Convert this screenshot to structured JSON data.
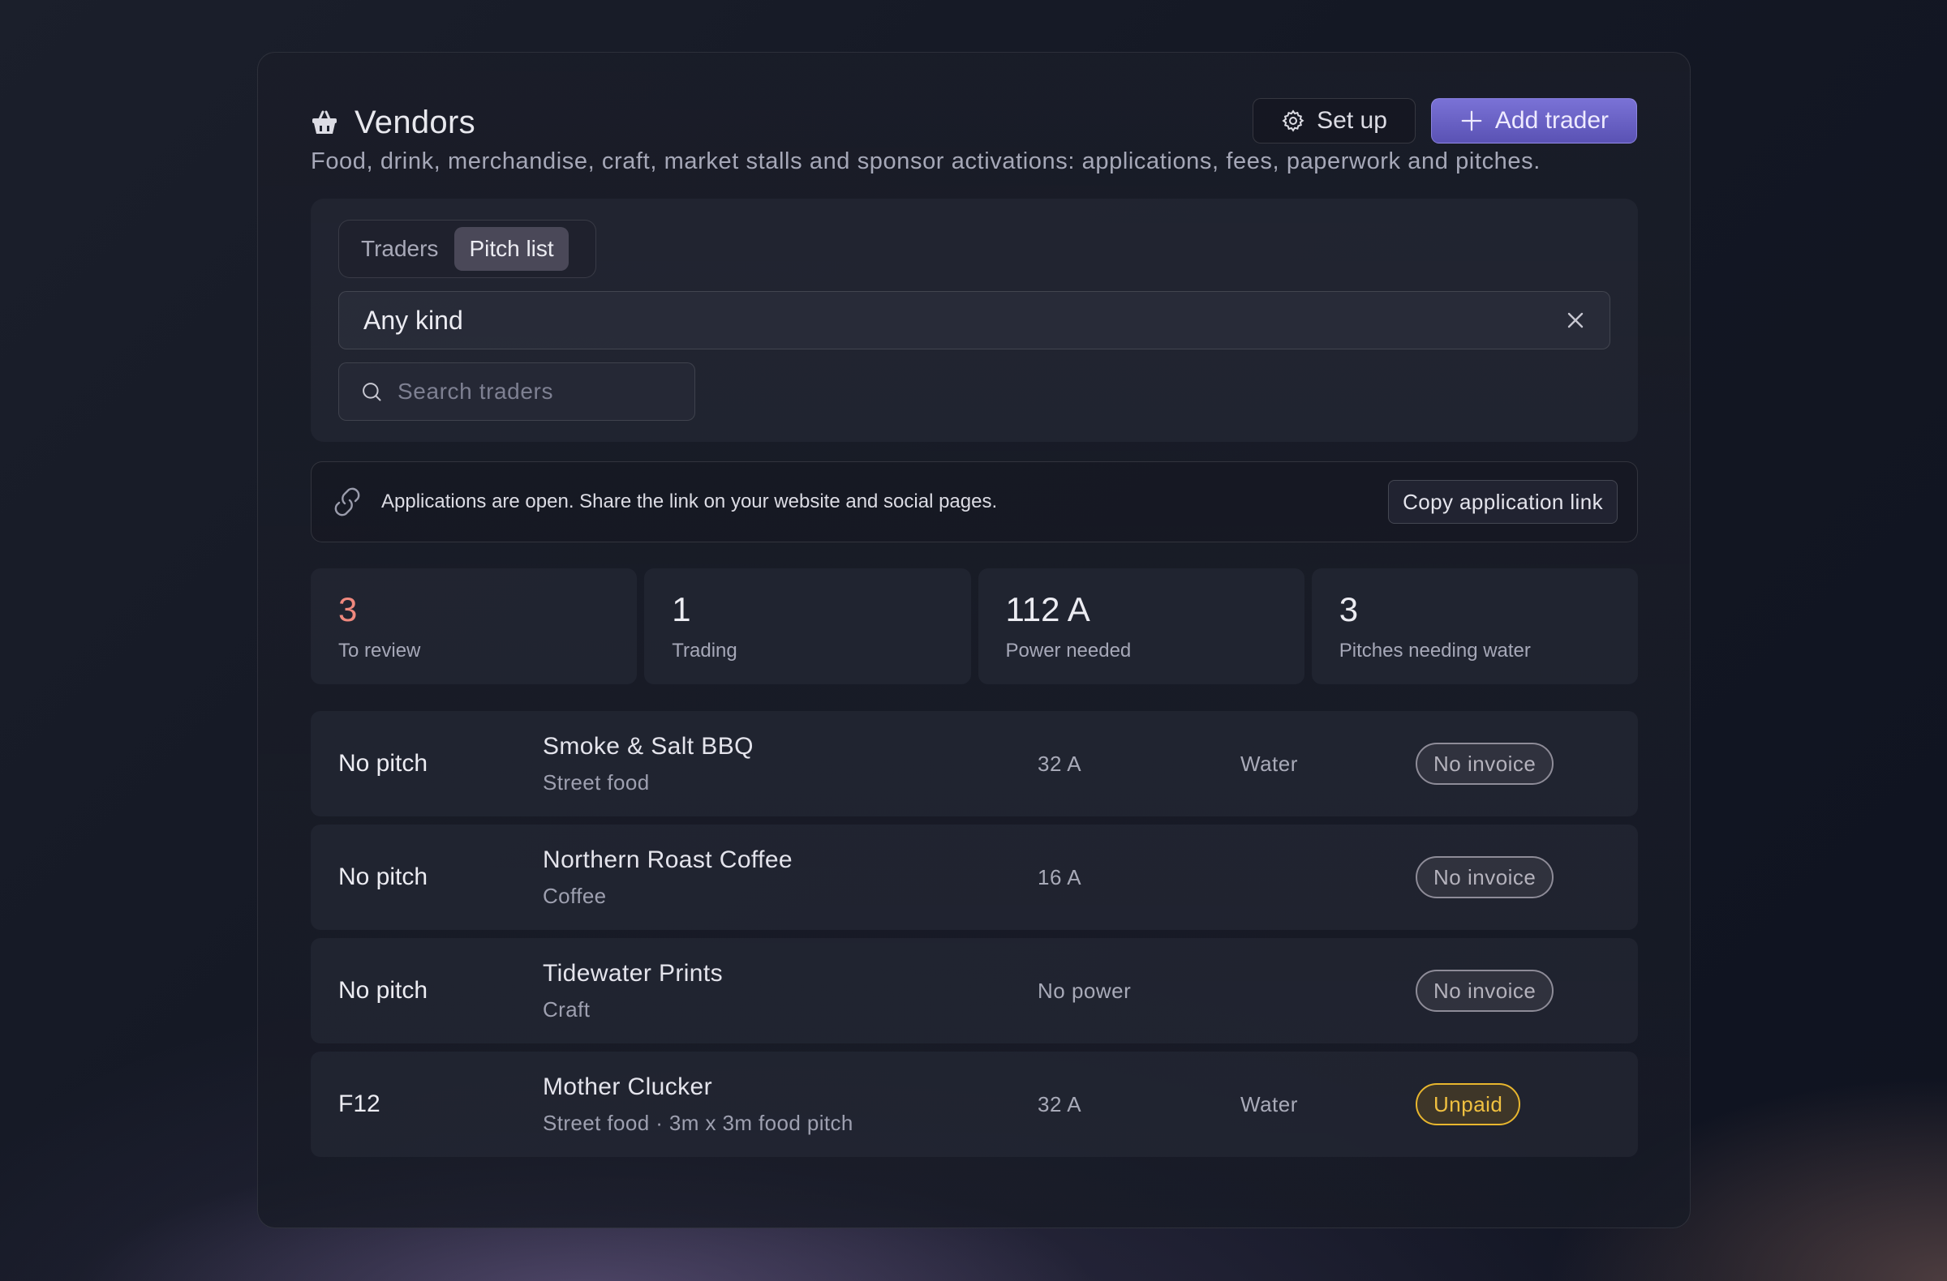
{
  "header": {
    "title": "Vendors",
    "subtitle": "Food, drink, merchandise, craft, market stalls and sponsor activations: applications, fees, paperwork and pitches.",
    "setup_label": "Set up",
    "add_label": "Add trader"
  },
  "filters": {
    "tabs": [
      {
        "label": "Traders",
        "active": false
      },
      {
        "label": "Pitch list",
        "active": true
      }
    ],
    "kind_value": "Any kind",
    "search_placeholder": "Search traders"
  },
  "banner": {
    "text": "Applications are open. Share the link on your website and social pages.",
    "button_label": "Copy application link"
  },
  "stats": [
    {
      "value": "3",
      "label": "To review",
      "highlight": true
    },
    {
      "value": "1",
      "label": "Trading",
      "highlight": false
    },
    {
      "value": "112 A",
      "label": "Power needed",
      "highlight": false
    },
    {
      "value": "3",
      "label": "Pitches needing water",
      "highlight": false
    }
  ],
  "rows": [
    {
      "pitch": "No pitch",
      "name": "Smoke & Salt BBQ",
      "kind": "Street food",
      "power": "32 A",
      "water": "Water",
      "status": "No invoice",
      "status_type": "none"
    },
    {
      "pitch": "No pitch",
      "name": "Northern Roast Coffee",
      "kind": "Coffee",
      "power": "16 A",
      "water": "",
      "status": "No invoice",
      "status_type": "none"
    },
    {
      "pitch": "No pitch",
      "name": "Tidewater Prints",
      "kind": "Craft",
      "power": "No power",
      "water": "",
      "status": "No invoice",
      "status_type": "none"
    },
    {
      "pitch": "F12",
      "name": "Mother Clucker",
      "kind": "Street food · 3m x 3m food pitch",
      "power": "32 A",
      "water": "Water",
      "status": "Unpaid",
      "status_type": "unpaid"
    }
  ],
  "colors": {
    "accent": "#6a62c8",
    "warning": "#f0897e",
    "unpaid": "#f0c040"
  }
}
